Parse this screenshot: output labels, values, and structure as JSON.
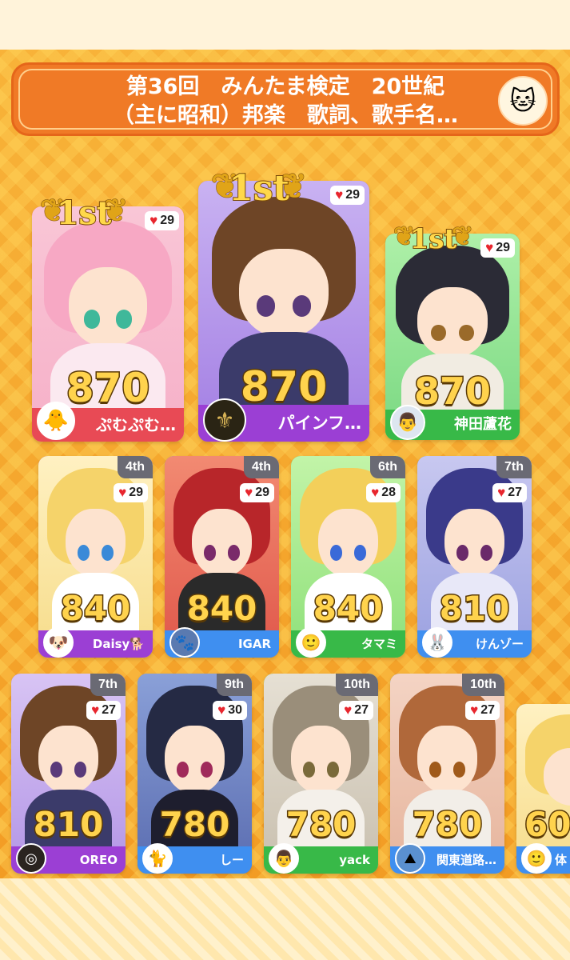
{
  "header": {
    "title": "第36回　みんたま検定　20世紀\n（主に昭和）邦楽　歌詞、歌手名…",
    "icon": "cat-avatar-icon"
  },
  "colors": {
    "accent": "#f07a26",
    "heart": "#e8262e",
    "score_fill": "#ffd34d",
    "rank_tab": "#6a6a74"
  },
  "top_players": [
    {
      "rank": "1st",
      "likes": "29",
      "score": "870",
      "name": "ぷむぷむ…",
      "theme": "#e84a55",
      "name_bg": "#e84a55"
    },
    {
      "rank": "1st",
      "likes": "29",
      "score": "870",
      "name": "パインフ…",
      "theme": "#a040d0",
      "name_bg": "#9b3fd4"
    },
    {
      "rank": "1st",
      "likes": "29",
      "score": "870",
      "name": "神田蘆花",
      "theme": "#3cc44c",
      "name_bg": "#38b948"
    }
  ],
  "row2": [
    {
      "rank": "4th",
      "likes": "29",
      "score": "840",
      "name": "Daisy🐕",
      "theme": "#9b3fd4"
    },
    {
      "rank": "4th",
      "likes": "29",
      "score": "840",
      "name": "IGAR",
      "theme": "#3f8ff0"
    },
    {
      "rank": "6th",
      "likes": "28",
      "score": "840",
      "name": "タマミ",
      "theme": "#38b948"
    },
    {
      "rank": "7th",
      "likes": "27",
      "score": "810",
      "name": "けんゾー",
      "theme": "#3f8ff0"
    }
  ],
  "row3": [
    {
      "rank": "7th",
      "likes": "27",
      "score": "810",
      "name": "OREO",
      "theme": "#9b3fd4"
    },
    {
      "rank": "9th",
      "likes": "30",
      "score": "780",
      "name": "しー",
      "theme": "#3f8ff0"
    },
    {
      "rank": "10th",
      "likes": "27",
      "score": "780",
      "name": "yack",
      "theme": "#38b948"
    },
    {
      "rank": "10th",
      "likes": "27",
      "score": "780",
      "name": "関東道路…",
      "theme": "#3f8ff0"
    },
    {
      "rank": "",
      "likes": "",
      "score": "60",
      "name": "体",
      "theme": "#3f8ff0"
    }
  ]
}
